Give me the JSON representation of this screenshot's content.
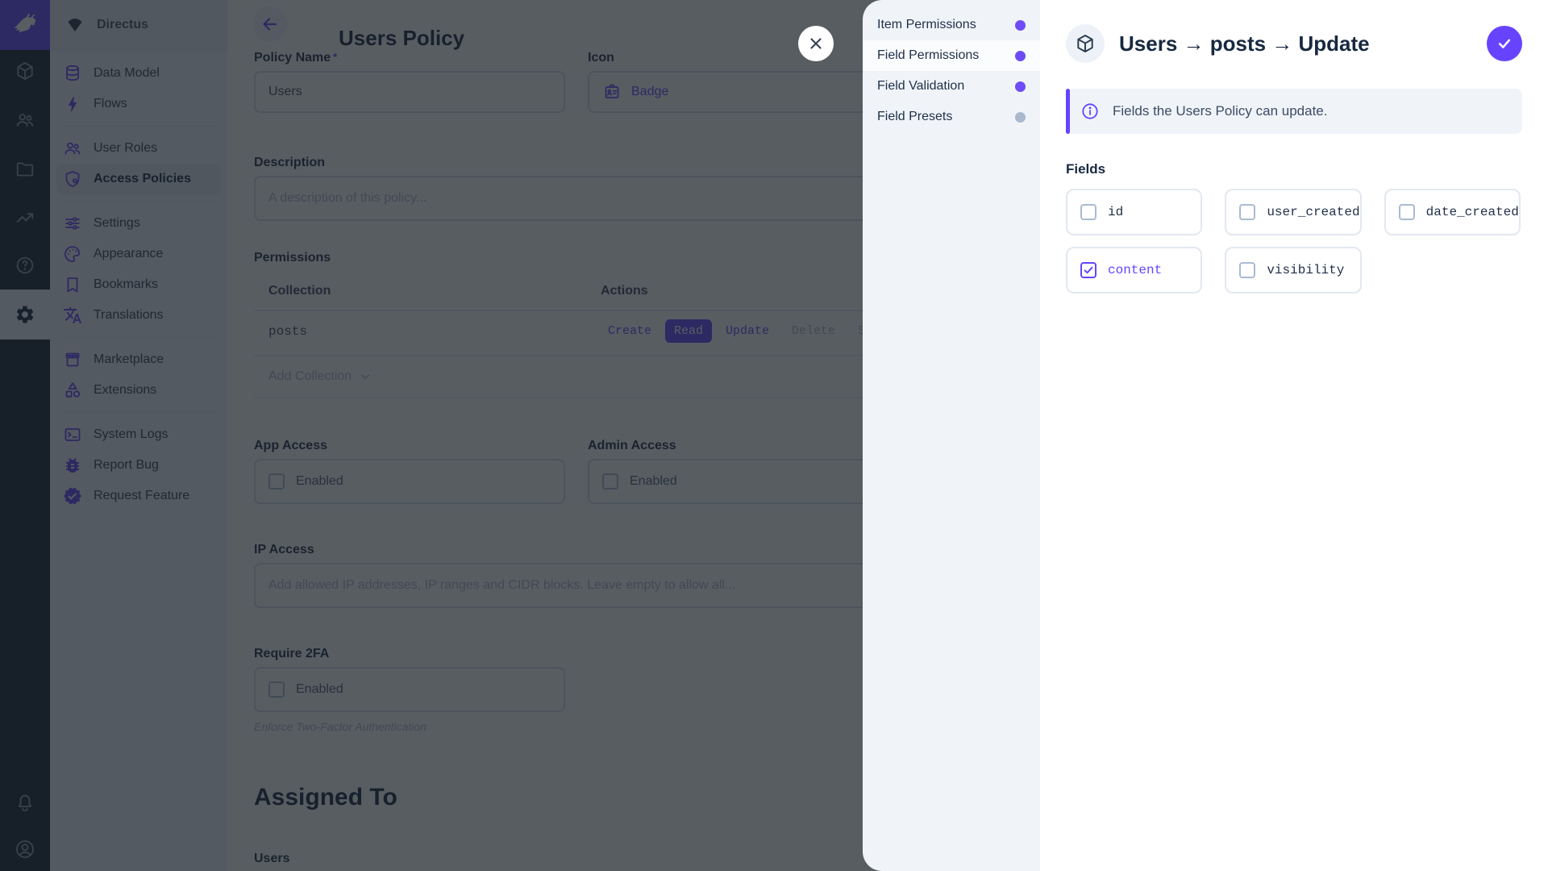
{
  "colors": {
    "accent": "#6644ff",
    "module_bar_bg": "#18222f",
    "sidebar_bg": "#f0f4f9",
    "dot_inactive": "#a9b8cc"
  },
  "module_bar": {
    "modules": [
      "directus-logo",
      "content",
      "users",
      "files",
      "insights",
      "help",
      "settings"
    ],
    "bottom": [
      "notifications",
      "account"
    ]
  },
  "nav": {
    "project_name": "Directus",
    "items": [
      {
        "label": "Data Model",
        "icon": "database"
      },
      {
        "label": "Flows",
        "icon": "bolt"
      },
      {
        "label": "User Roles",
        "icon": "group"
      },
      {
        "label": "Access Policies",
        "icon": "shield-lock",
        "active": true
      },
      {
        "label": "Settings",
        "icon": "tune"
      },
      {
        "label": "Appearance",
        "icon": "palette"
      },
      {
        "label": "Bookmarks",
        "icon": "bookmark"
      },
      {
        "label": "Translations",
        "icon": "translate"
      },
      {
        "label": "Marketplace",
        "icon": "storefront"
      },
      {
        "label": "Extensions",
        "icon": "category"
      },
      {
        "label": "System Logs",
        "icon": "terminal"
      },
      {
        "label": "Report Bug",
        "icon": "bug"
      },
      {
        "label": "Request Feature",
        "icon": "new-releases"
      }
    ]
  },
  "page": {
    "title": "Users Policy",
    "policy_name": {
      "label": "Policy Name",
      "required_mark": "*",
      "value": "Users"
    },
    "icon_field": {
      "label": "Icon",
      "value": "Badge"
    },
    "description": {
      "label": "Description",
      "placeholder": "A description of this policy..."
    },
    "permissions": {
      "label": "Permissions",
      "columns": {
        "collection": "Collection",
        "actions": "Actions"
      },
      "rows": [
        {
          "collection": "posts",
          "actions": [
            {
              "label": "Create",
              "state": "enabled"
            },
            {
              "label": "Read",
              "state": "selected"
            },
            {
              "label": "Update",
              "state": "enabled"
            },
            {
              "label": "Delete",
              "state": "disabled"
            },
            {
              "label": "Share",
              "state": "disabled"
            }
          ]
        }
      ],
      "add_label": "Add Collection"
    },
    "app_access": {
      "label": "App Access",
      "checkbox_label": "Enabled",
      "checked": false
    },
    "admin_access": {
      "label": "Admin Access",
      "checkbox_label": "Enabled",
      "checked": false
    },
    "ip_access": {
      "label": "IP Access",
      "placeholder": "Add allowed IP addresses, IP ranges and CIDR blocks. Leave empty to allow all..."
    },
    "require_2fa": {
      "label": "Require 2FA",
      "checkbox_label": "Enabled",
      "checked": false,
      "note": "Enforce Two-Factor Authentication"
    },
    "assigned_to": {
      "heading": "Assigned To",
      "sub_label": "Users"
    }
  },
  "drawer": {
    "nav": [
      {
        "label": "Item Permissions",
        "dot_color": "#6644ff",
        "active": false
      },
      {
        "label": "Field Permissions",
        "dot_color": "#6644ff",
        "active": true
      },
      {
        "label": "Field Validation",
        "dot_color": "#6644ff",
        "active": false
      },
      {
        "label": "Field Presets",
        "dot_color": "#a9b8cc",
        "active": false
      }
    ],
    "title": "Users → posts → Update",
    "notice": "Fields the Users Policy can update.",
    "fields_label": "Fields",
    "checkboxes": [
      {
        "label": "id",
        "checked": false
      },
      {
        "label": "user_created",
        "checked": false
      },
      {
        "label": "date_created",
        "checked": false
      },
      {
        "label": "content",
        "checked": true
      },
      {
        "label": "visibility",
        "checked": false
      }
    ]
  }
}
